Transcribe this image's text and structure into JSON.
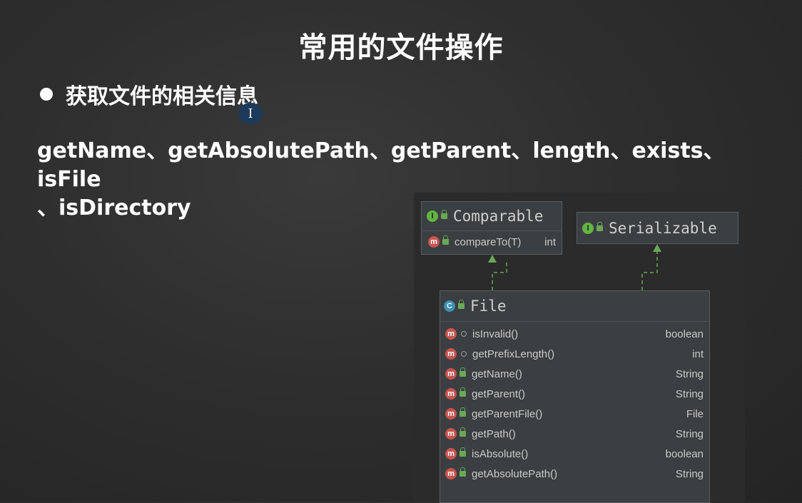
{
  "slide": {
    "title": "常用的文件操作",
    "bullet": "获取文件的相关信息",
    "methods_line1": "getName、getAbsolutePath、getParent、length、exists、isFile",
    "methods_line2": "、isDirectory",
    "cursor_glyph": "I"
  },
  "uml": {
    "comparable": {
      "badge": "I",
      "name": "Comparable",
      "method_badge": "m",
      "method": "compareTo(T)",
      "return": "int"
    },
    "serializable": {
      "badge": "I",
      "name": "Serializable"
    },
    "file": {
      "badge": "C",
      "name": "File",
      "methods": [
        {
          "badge": "m",
          "name": "isInvalid()",
          "return": "boolean",
          "access": "package"
        },
        {
          "badge": "m",
          "name": "getPrefixLength()",
          "return": "int",
          "access": "package"
        },
        {
          "badge": "m",
          "name": "getName()",
          "return": "String",
          "access": "public"
        },
        {
          "badge": "m",
          "name": "getParent()",
          "return": "String",
          "access": "public"
        },
        {
          "badge": "m",
          "name": "getParentFile()",
          "return": "File",
          "access": "public"
        },
        {
          "badge": "m",
          "name": "getPath()",
          "return": "String",
          "access": "public"
        },
        {
          "badge": "m",
          "name": "isAbsolute()",
          "return": "boolean",
          "access": "public"
        },
        {
          "badge": "m",
          "name": "getAbsolutePath()",
          "return": "String",
          "access": "public"
        }
      ]
    },
    "colors": {
      "arrow": "#6aa858",
      "interface_badge": "#62b543",
      "class_badge": "#3d8fb4",
      "method_badge": "#c75450"
    }
  }
}
